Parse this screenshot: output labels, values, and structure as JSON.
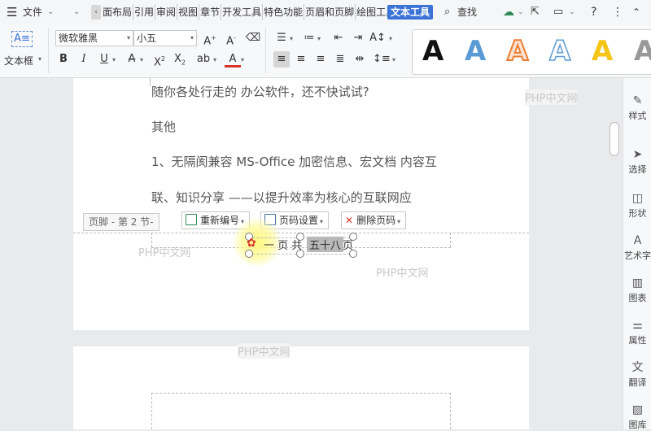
{
  "menubar": {
    "file_label": "文件",
    "tabs": [
      "面布局",
      "引用",
      "审阅",
      "视图",
      "章节",
      "开发工具",
      "特色功能",
      "页眉和页脚",
      "绘图工具"
    ],
    "active_tab": "文本工具",
    "search_label": "查找"
  },
  "ribbon": {
    "textbox_label": "文本框",
    "font_name": "微软雅黑",
    "font_size": "小五",
    "styles_gallery": [
      {
        "letter": "A",
        "color": "#111111",
        "style": "solid"
      },
      {
        "letter": "A",
        "color": "#5b9bd5",
        "style": "solid"
      },
      {
        "letter": "A",
        "color": "#ed7d31",
        "style": "outline"
      },
      {
        "letter": "A",
        "color": "#5b9bd5",
        "style": "outline"
      },
      {
        "letter": "A",
        "color": "#f5c518",
        "style": "solid"
      },
      {
        "letter": "A",
        "color": "#999999",
        "style": "solid"
      }
    ]
  },
  "document": {
    "lines": [
      "随你各处行走的 办公软件，还不快试试?",
      "其他",
      "1、无隔阂兼容 MS-Office 加密信息、宏文档  内容互",
      "联、知识分享 ——以提升效率为核心的互联网应"
    ],
    "footer_tag": "页脚 - 第 2 节-",
    "footer_buttons": {
      "renumber": "重新编号",
      "page_settings": "页码设置",
      "delete_page_number": "删除页码"
    },
    "page_number": {
      "part1": "一 页 共",
      "part2": "五十八",
      "part3": "页"
    },
    "watermark": "PHP中文网"
  },
  "sidebar": {
    "items": [
      "样式",
      "选择",
      "形状",
      "艺术字",
      "图表",
      "属性",
      "翻译",
      "图库"
    ]
  },
  "colors": {
    "active_tab": "#3b74d6",
    "delete_icon": "#d9342b"
  }
}
